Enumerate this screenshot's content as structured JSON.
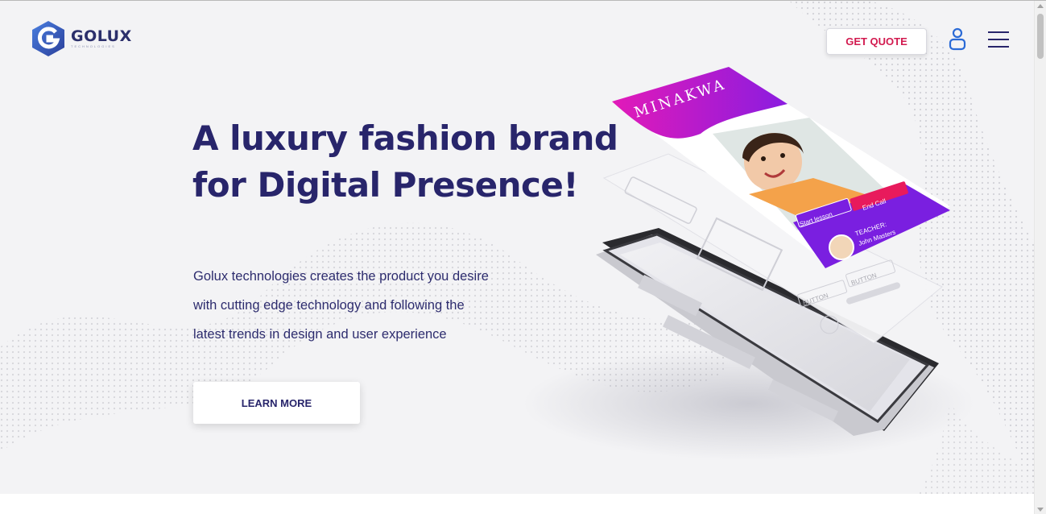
{
  "brand": {
    "name": "GOLUX",
    "tagline": "TECHNOLOGIES",
    "primary_color": "#28256b",
    "accent_color": "#d21a4f"
  },
  "header": {
    "quote_label": "GET QUOTE",
    "user_icon": "user-icon",
    "menu_icon": "hamburger-menu-icon"
  },
  "hero": {
    "headline_line1": "A luxury fashion brand",
    "headline_line2": "for Digital Presence!",
    "desc_line1": "Golux technologies creates the product you desire",
    "desc_line2": "with cutting edge technology and following the",
    "desc_line3": "latest trends in design and user experience",
    "cta_label": "LEARN MORE"
  },
  "app_mockup": {
    "app_name": "MINAKWA",
    "start_label": "Start lesson",
    "end_label": "End Call",
    "teacher_title": "TEACHER:",
    "teacher_name": "John Masters",
    "wire_button_1": "BUTTON",
    "wire_button_2": "BUTTON"
  }
}
